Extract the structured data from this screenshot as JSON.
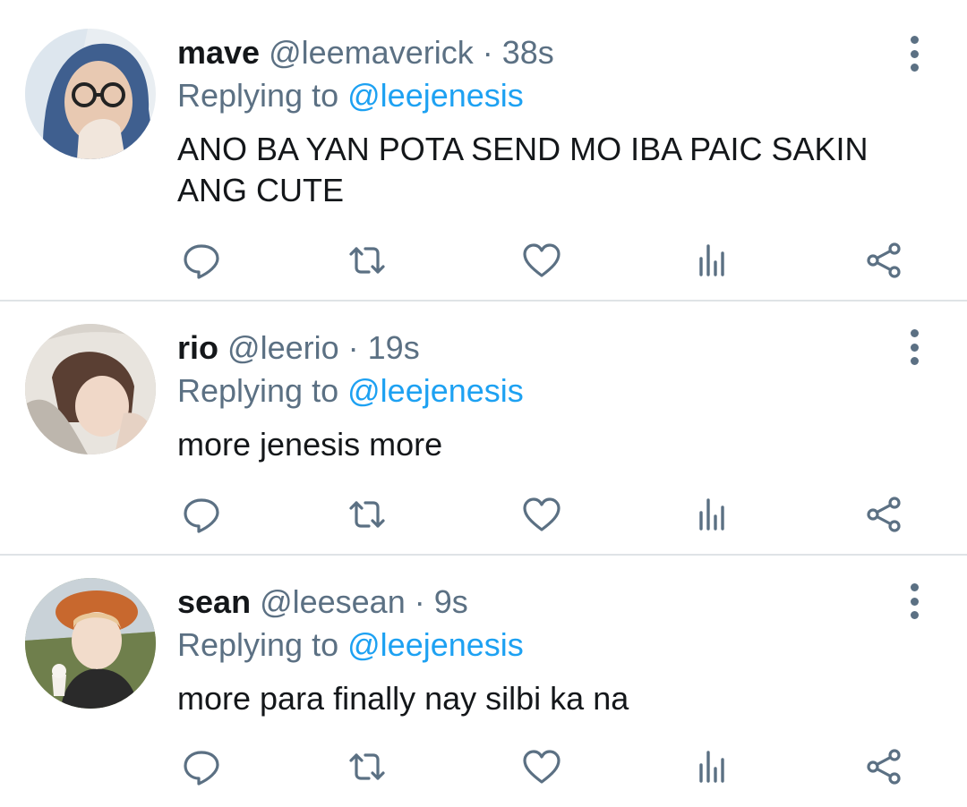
{
  "colors": {
    "text_primary": "#14171a",
    "text_secondary": "#5b7083",
    "mention": "#1da1f2",
    "divider": "#dfe3e6"
  },
  "replying_prefix": "Replying to",
  "tweets": [
    {
      "name": "mave",
      "handle": "@leemaverick",
      "separator": "·",
      "time": "38s",
      "replying_to": "@leejenesis",
      "text_line1": "ANO BA YAN POTA SEND MO IBA PAIC SAKIN",
      "text_line2": "ANG CUTE"
    },
    {
      "name": "rio",
      "handle": "@leerio",
      "separator": "·",
      "time": "19s",
      "replying_to": "@leejenesis",
      "text_line1": "more jenesis more"
    },
    {
      "name": "sean",
      "handle": "@leesean",
      "separator": "·",
      "time": "9s",
      "replying_to": "@leejenesis",
      "text_line1": "more para finally nay silbi ka na"
    }
  ],
  "action_icons": [
    "reply-icon",
    "retweet-icon",
    "like-icon",
    "analytics-icon",
    "share-icon"
  ]
}
